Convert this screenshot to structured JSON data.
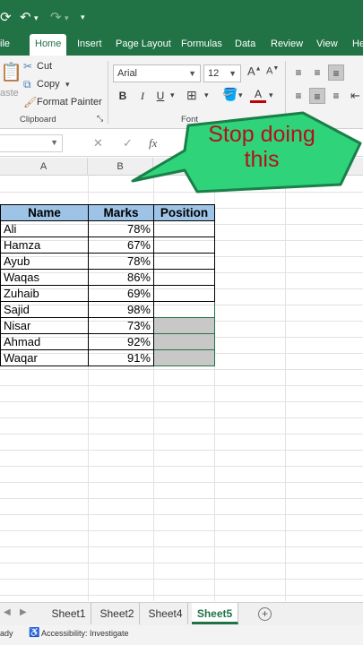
{
  "quick_access": {
    "autosave_icon": "autosave-icon",
    "undo_icon": "undo-icon",
    "redo_icon": "redo-icon",
    "customize_icon": "customize-icon"
  },
  "tabs": [
    "ile",
    "Home",
    "Insert",
    "Page Layout",
    "Formulas",
    "Data",
    "Review",
    "View",
    "He"
  ],
  "active_tab": "Home",
  "clipboard": {
    "paste_label": "aste",
    "cut_label": "Cut",
    "copy_label": "Copy",
    "format_painter_label": "Format Painter",
    "group_label": "Clipboard"
  },
  "font": {
    "name": "Arial",
    "size": "12",
    "bold": "B",
    "italic": "I",
    "underline": "U",
    "font_color_glyph": "A",
    "group_label": "Font"
  },
  "formula_bar": {
    "fx": "fx"
  },
  "columns": [
    "A",
    "B"
  ],
  "table": {
    "headers": [
      "Name",
      "Marks",
      "Position"
    ],
    "rows": [
      [
        "Ali",
        "78%",
        ""
      ],
      [
        "Hamza",
        "67%",
        ""
      ],
      [
        "Ayub",
        "78%",
        ""
      ],
      [
        "Waqas",
        "86%",
        ""
      ],
      [
        "Zuhaib",
        "69%",
        ""
      ],
      [
        "Sajid",
        "98%",
        ""
      ],
      [
        "Nisar",
        "73%",
        ""
      ],
      [
        "Ahmad",
        "92%",
        ""
      ],
      [
        "Waqar",
        "91%",
        ""
      ]
    ]
  },
  "callout": {
    "line1": "Stop doing",
    "line2": "this",
    "fill_color": "#2fd37a",
    "text_color": "#b3121a"
  },
  "sheets": [
    "Sheet1",
    "Sheet2",
    "Sheet4",
    "Sheet5"
  ],
  "active_sheet": "Sheet5",
  "status": {
    "ready": "ady",
    "accessibility": "Accessibility: Investigate"
  },
  "colors": {
    "excel_green": "#217346",
    "header_fill": "#9dc3e6",
    "selected_fill": "#c8c8c8"
  }
}
